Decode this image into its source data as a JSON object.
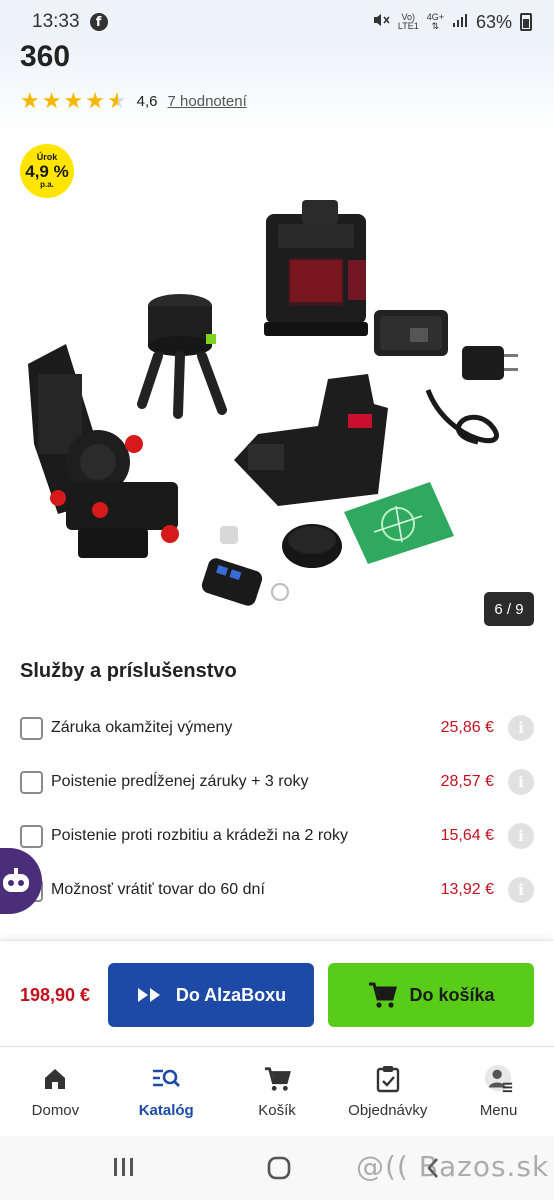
{
  "status_bar": {
    "time": "13:33",
    "network_top": "Vo)",
    "network_bottom": "LTE1",
    "gen": "4G+",
    "battery": "63%"
  },
  "product": {
    "title": "360",
    "rating": 4.6,
    "rating_value": "4,6",
    "rating_link": "7 hodnotení",
    "interest_badge": {
      "line1": "Úrok",
      "line2": "4,9 %",
      "line3": "p.a."
    },
    "image_pager": "6 / 9"
  },
  "services": {
    "heading": "Služby a príslušenstvo",
    "items": [
      {
        "label": "Záruka okamžitej výmeny",
        "price": "25,86 €"
      },
      {
        "label": "Poistenie predĺženej záruky + 3 roky",
        "price": "28,57 €"
      },
      {
        "label": "Poistenie proti rozbitiu a krádeži na 2 roky",
        "price": "15,64 €"
      },
      {
        "label": "Možnosť vrátiť tovar do 60 dní",
        "price": "13,92 €"
      }
    ]
  },
  "purchase": {
    "price": "198,90 €",
    "alzabox_label": "Do AlzaBoxu",
    "cart_label": "Do košíka"
  },
  "bottom_nav": {
    "items": [
      {
        "label": "Domov",
        "icon": "home-icon",
        "active": false
      },
      {
        "label": "Katalóg",
        "icon": "catalog-search-icon",
        "active": true
      },
      {
        "label": "Košík",
        "icon": "cart-icon",
        "active": false
      },
      {
        "label": "Objednávky",
        "icon": "orders-icon",
        "active": false
      },
      {
        "label": "Menu",
        "icon": "user-menu-icon",
        "active": false
      }
    ]
  },
  "watermark": "@(( Bazos.sk",
  "colors": {
    "accent_blue": "#1c4aa6",
    "accent_green": "#59cc1a",
    "price_red": "#c2121f",
    "badge_yellow": "#ffe500",
    "star": "#f5b800"
  }
}
